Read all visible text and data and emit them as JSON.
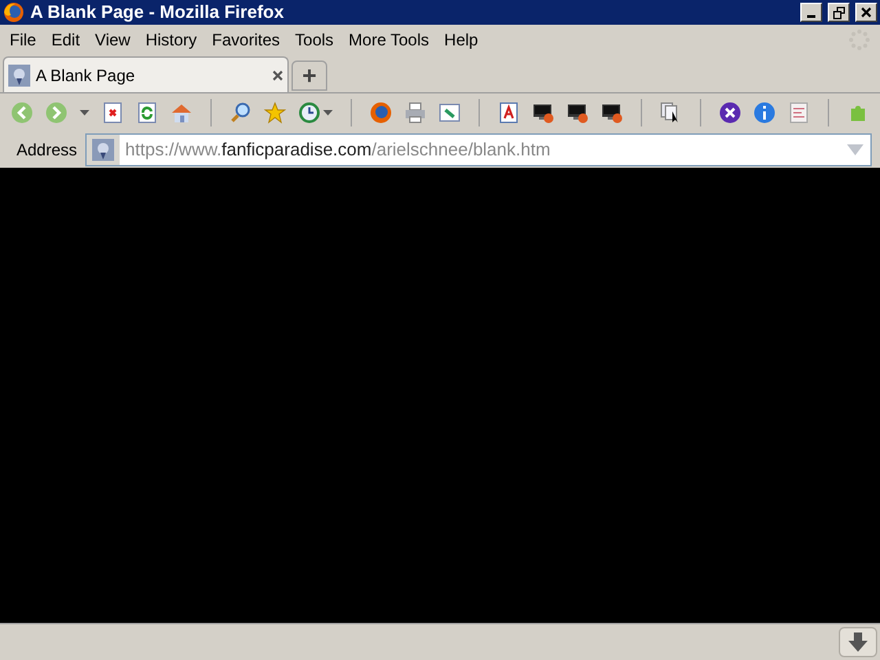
{
  "window": {
    "title": "A Blank Page - Mozilla Firefox"
  },
  "menu": [
    "File",
    "Edit",
    "View",
    "History",
    "Favorites",
    "Tools",
    "More Tools",
    "Help"
  ],
  "tabs": [
    {
      "label": "A Blank Page",
      "selected": true
    }
  ],
  "new_tab": "+",
  "address": {
    "label": "Address",
    "url_prefix": "https://www.",
    "url_domain": "fanficparadise.com",
    "url_path": "/arielschnee/blank.htm"
  }
}
